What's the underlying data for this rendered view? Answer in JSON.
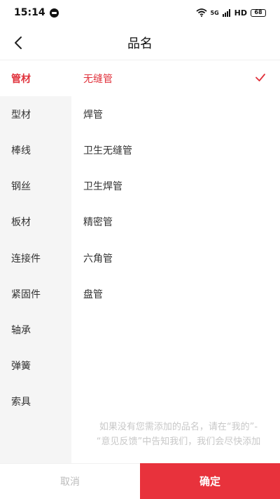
{
  "status_bar": {
    "time": "15:14",
    "network": "5G",
    "hd": "HD",
    "battery": "68"
  },
  "header": {
    "title": "品名",
    "back_icon": "chevron-left-icon"
  },
  "categories": [
    {
      "label": "管材",
      "selected": true
    },
    {
      "label": "型材",
      "selected": false
    },
    {
      "label": "棒线",
      "selected": false
    },
    {
      "label": "钢丝",
      "selected": false
    },
    {
      "label": "板材",
      "selected": false
    },
    {
      "label": "连接件",
      "selected": false
    },
    {
      "label": "紧固件",
      "selected": false
    },
    {
      "label": "轴承",
      "selected": false
    },
    {
      "label": "弹簧",
      "selected": false
    },
    {
      "label": "索具",
      "selected": false
    }
  ],
  "subitems": [
    {
      "label": "无缝管",
      "selected": true
    },
    {
      "label": "焊管",
      "selected": false
    },
    {
      "label": "卫生无缝管",
      "selected": false
    },
    {
      "label": "卫生焊管",
      "selected": false
    },
    {
      "label": "精密管",
      "selected": false
    },
    {
      "label": "六角管",
      "selected": false
    },
    {
      "label": "盘管",
      "selected": false
    }
  ],
  "hint": {
    "line1": "如果没有您需添加的品名，请在“我的”-",
    "line2": "“意见反馈”中告知我们，我们会尽快添加"
  },
  "footer": {
    "cancel_label": "取消",
    "confirm_label": "确定"
  },
  "colors": {
    "accent": "#e8323c",
    "selected_text": "#e0303a",
    "sidebar_bg": "#f5f5f5"
  }
}
